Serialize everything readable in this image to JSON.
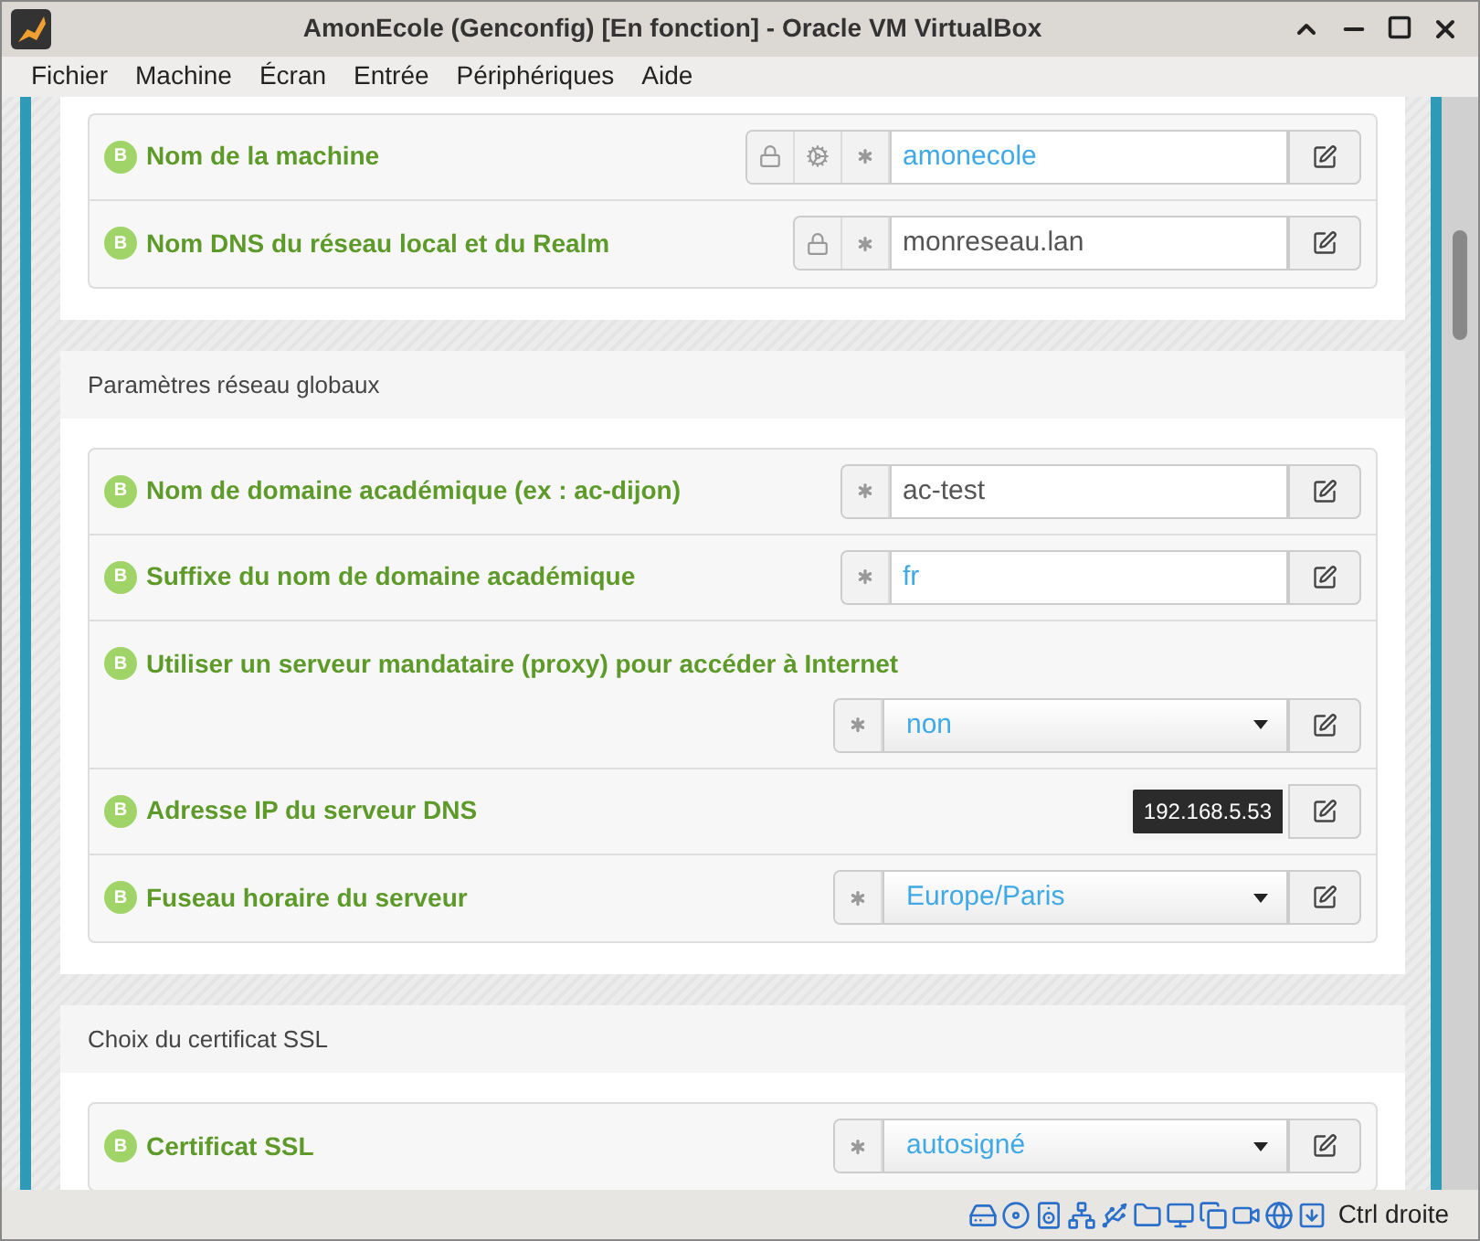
{
  "window": {
    "title": "AmonEcole (Genconfig) [En fonction] - Oracle VM VirtualBox"
  },
  "menu": [
    "Fichier",
    "Machine",
    "Écran",
    "Entrée",
    "Périphériques",
    "Aide"
  ],
  "sections": [
    {
      "rows": [
        {
          "badge": "B",
          "label": "Nom de la machine",
          "kind": "text",
          "addons": [
            {
              "kind": "lock"
            },
            {
              "kind": "gears"
            },
            {
              "kind": "asterisk"
            }
          ],
          "value": "amonecole",
          "default": true
        },
        {
          "badge": "B",
          "label": "Nom DNS du réseau local et du Realm",
          "kind": "text",
          "addons": [
            {
              "kind": "lock"
            },
            {
              "kind": "asterisk"
            }
          ],
          "value": "monreseau.lan",
          "default": false
        }
      ]
    },
    {
      "title": "Paramètres réseau globaux",
      "rows": [
        {
          "badge": "B",
          "label": "Nom de domaine académique (ex : ac-dijon)",
          "kind": "text",
          "addons": [
            {
              "kind": "asterisk"
            }
          ],
          "value": "ac-test",
          "default": false
        },
        {
          "badge": "B",
          "label": "Suffixe du nom de domaine académique",
          "kind": "text",
          "addons": [
            {
              "kind": "asterisk"
            }
          ],
          "value": "fr",
          "default": true
        },
        {
          "badge": "B",
          "label": "Utiliser un serveur mandataire (proxy) pour accéder à Internet",
          "kind": "select",
          "stacked": true,
          "addons": [
            {
              "kind": "asterisk"
            }
          ],
          "value": "non",
          "default": true
        },
        {
          "badge": "B",
          "label": "Adresse IP du serveur DNS",
          "kind": "list",
          "value": "192.168.5.53"
        },
        {
          "badge": "B",
          "label": "Fuseau horaire du serveur",
          "kind": "select",
          "addons": [
            {
              "kind": "asterisk"
            }
          ],
          "value": "Europe/Paris",
          "default": true
        }
      ]
    },
    {
      "title": "Choix du certificat SSL",
      "rows": [
        {
          "badge": "B",
          "label": "Certificat SSL",
          "kind": "select",
          "addons": [
            {
              "kind": "asterisk"
            }
          ],
          "value": "autosigné",
          "default": true
        }
      ]
    }
  ],
  "status_bar": {
    "host_key": "Ctrl droite"
  }
}
